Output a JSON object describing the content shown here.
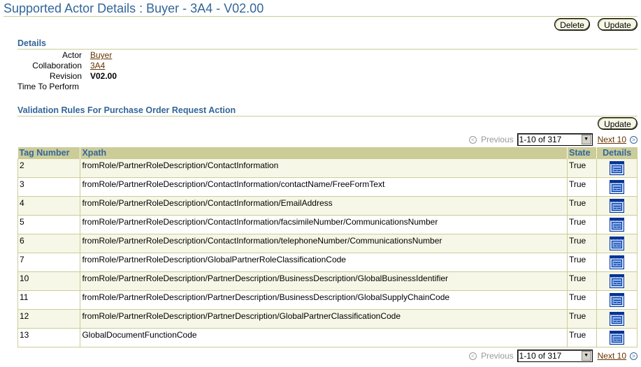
{
  "page": {
    "title": "Supported Actor Details : Buyer - 3A4 - V02.00"
  },
  "actions": {
    "delete_label": "Delete",
    "update_label": "Update"
  },
  "details": {
    "header": "Details",
    "fields": [
      {
        "label": "Actor",
        "value": "Buyer",
        "type": "link"
      },
      {
        "label": "Collaboration",
        "value": "3A4",
        "type": "link"
      },
      {
        "label": "Revision",
        "value": "V02.00",
        "type": "bold"
      },
      {
        "label": "Time To Perform",
        "value": "",
        "type": "text"
      }
    ]
  },
  "rules": {
    "header": "Validation Rules For Purchase Order Request Action",
    "update_label": "Update",
    "navigation": {
      "previous_label": "Previous",
      "range_selected": "1-10 of 317",
      "next_label": "Next 10"
    },
    "columns": [
      "Tag Number",
      "Xpath",
      "State",
      "Details"
    ],
    "rows": [
      {
        "tag": "2",
        "xpath": "fromRole/PartnerRoleDescription/ContactInformation",
        "state": "True",
        "details_icon": "details-icon"
      },
      {
        "tag": "3",
        "xpath": "fromRole/PartnerRoleDescription/ContactInformation/contactName/FreeFormText",
        "state": "True",
        "details_icon": "details-icon"
      },
      {
        "tag": "4",
        "xpath": "fromRole/PartnerRoleDescription/ContactInformation/EmailAddress",
        "state": "True",
        "details_icon": "details-icon"
      },
      {
        "tag": "5",
        "xpath": "fromRole/PartnerRoleDescription/ContactInformation/facsimileNumber/CommunicationsNumber",
        "state": "True",
        "details_icon": "details-icon"
      },
      {
        "tag": "6",
        "xpath": "fromRole/PartnerRoleDescription/ContactInformation/telephoneNumber/CommunicationsNumber",
        "state": "True",
        "details_icon": "details-icon"
      },
      {
        "tag": "7",
        "xpath": "fromRole/PartnerRoleDescription/GlobalPartnerRoleClassificationCode",
        "state": "True",
        "details_icon": "details-icon"
      },
      {
        "tag": "10",
        "xpath": "fromRole/PartnerRoleDescription/PartnerDescription/BusinessDescription/GlobalBusinessIdentifier",
        "state": "True",
        "details_icon": "details-icon"
      },
      {
        "tag": "11",
        "xpath": "fromRole/PartnerRoleDescription/PartnerDescription/BusinessDescription/GlobalSupplyChainCode",
        "state": "True",
        "details_icon": "details-icon"
      },
      {
        "tag": "12",
        "xpath": "fromRole/PartnerRoleDescription/PartnerDescription/GlobalPartnerClassificationCode",
        "state": "True",
        "details_icon": "details-icon"
      },
      {
        "tag": "13",
        "xpath": "GlobalDocumentFunctionCode",
        "state": "True",
        "details_icon": "details-icon"
      }
    ]
  }
}
